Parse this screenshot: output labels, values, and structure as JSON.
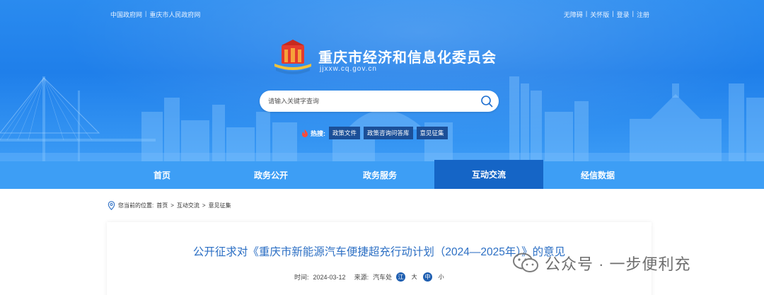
{
  "top_links": {
    "left1": "中国政府网",
    "sep": "|",
    "left2": "重庆市人民政府网",
    "right": [
      "无障碍",
      "关怀版",
      "登录",
      "注册"
    ]
  },
  "site": {
    "title": "重庆市经济和信息化委员会",
    "domain": "jjxxw.cq.gov.cn"
  },
  "search": {
    "placeholder": "请输入关键字查询"
  },
  "hot": {
    "label": "热搜:",
    "tags": [
      "政策文件",
      "政策咨询问答库",
      "意见征集"
    ]
  },
  "nav": {
    "items": [
      "首页",
      "政务公开",
      "政务服务",
      "互动交流",
      "经信数据"
    ],
    "active_index": 3
  },
  "breadcrumb": {
    "prefix": "您当前的位置:",
    "home": "首页",
    "level1": "互动交流",
    "level2": "意见征集",
    "sep": ">"
  },
  "article": {
    "title": "公开征求对《重庆市新能源汽车便捷超充行动计划（2024—2025年）》的意见",
    "time_label": "时间:",
    "time": "2024-03-12",
    "source_label": "来源:",
    "source": "汽车处",
    "sizes": [
      "江",
      "大",
      "中",
      "小"
    ]
  },
  "watermark": {
    "text": "公众号 · 一步便利充"
  },
  "colors": {
    "banner": "#1f7fea",
    "nav": "#3d9ef5",
    "nav_active": "#1565c6",
    "title": "#2c6fc4",
    "tag": "#1b4f98"
  }
}
